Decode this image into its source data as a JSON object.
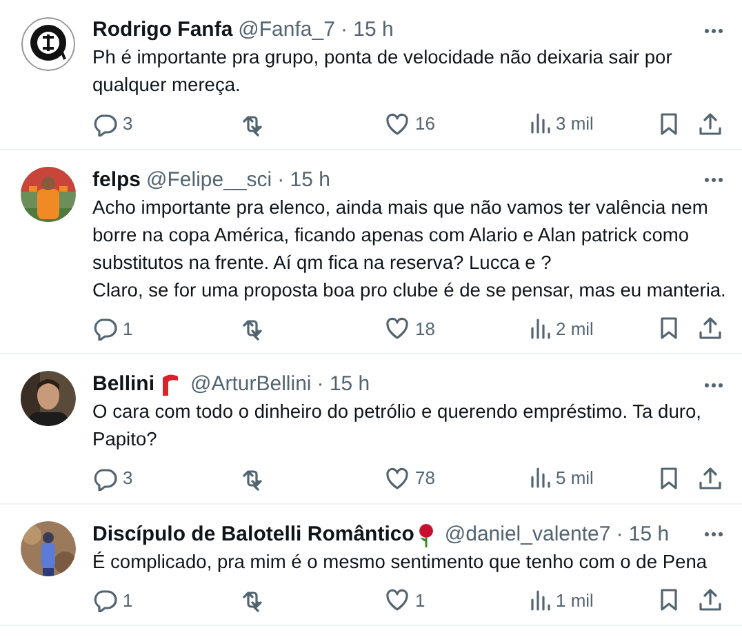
{
  "replies": [
    {
      "name": "Rodrigo Fanfa",
      "handle": "@Fanfa_7",
      "time": "· 15 h",
      "avatar": {
        "kind": "crest"
      },
      "lines": [
        "Ph é importante pra grupo, ponta de velocidade não deixaria sair por",
        "qualquer mereça."
      ],
      "replies": "3",
      "likes": "16",
      "views": "3 mil"
    },
    {
      "name": "felps",
      "handle": "@Felipe__sci",
      "time": "· 15 h",
      "avatar": {
        "kind": "picture"
      },
      "lines": [
        "Acho importante pra elenco, ainda mais que não vamos ter valência nem",
        "borre na copa América, ficando apenas com Alario e Alan patrick como",
        "substitutos na frente. Aí qm fica na reserva? Lucca e ?",
        "Claro, se for uma proposta boa pro clube é de se pensar, mas eu manteria."
      ],
      "replies": "1",
      "likes": "18",
      "views": "2 mil"
    },
    {
      "name": "Bellini",
      "badge": {
        "kind": "flag"
      },
      "handle": "@ArturBellini",
      "time": "· 15 h",
      "avatar": {
        "kind": "picture"
      },
      "lines": [
        "O cara com todo o dinheiro do petrólio e querendo empréstimo. Ta duro,",
        "Papito?"
      ],
      "replies": "3",
      "likes": "78",
      "views": "5 mil"
    },
    {
      "name": "Discípulo de Balotelli Romântico",
      "badge": {
        "kind": "rose"
      },
      "handle": "@daniel_valente7",
      "time": "· 15 h",
      "avatar": {
        "kind": "picture"
      },
      "lines": [
        "É complicado, pra mim é o mesmo sentimento que tenho com o de Pena"
      ],
      "replies": "1",
      "likes": "1",
      "views": "1 mil"
    }
  ]
}
